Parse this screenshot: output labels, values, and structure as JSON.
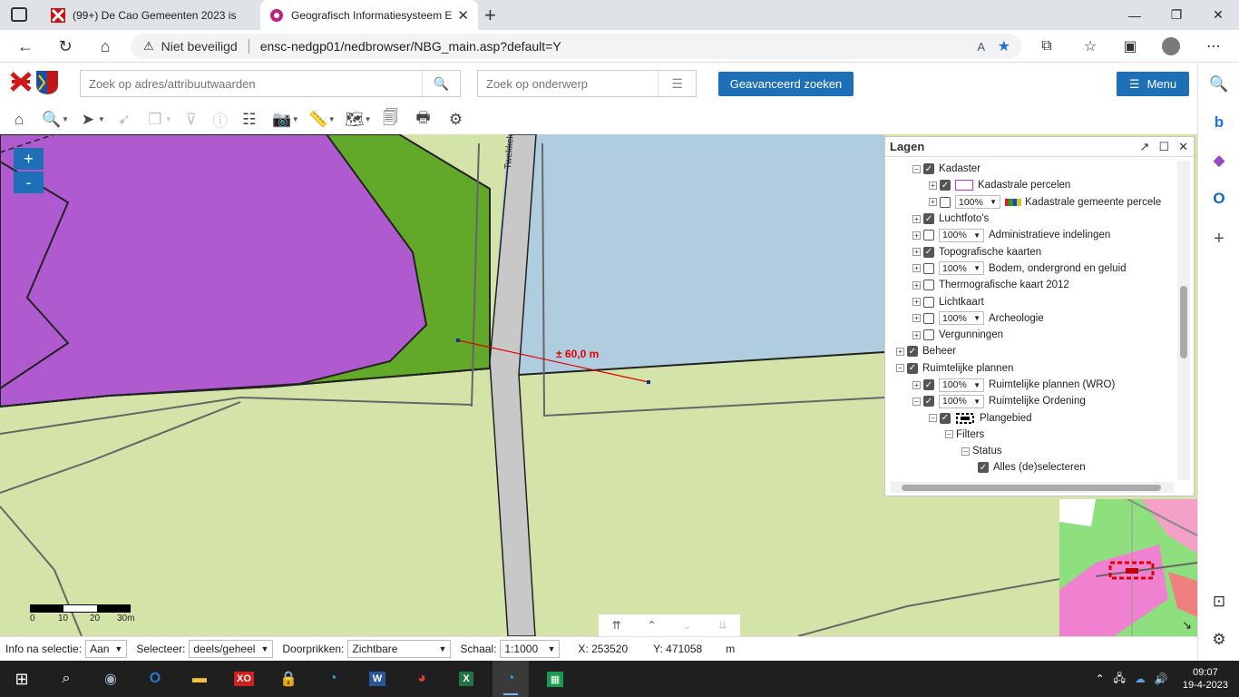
{
  "browser": {
    "tabs": [
      {
        "title": "(99+) De Cao Gemeenten 2023 is"
      },
      {
        "title": "Geografisch Informatiesysteem E"
      }
    ],
    "address": {
      "security": "Niet beveiligd",
      "url": "ensc-nedgp01/nedbrowser/NBG_main.asp?default=Y"
    }
  },
  "app": {
    "search_address_placeholder": "Zoek op adres/attribuutwaarden",
    "search_subject_placeholder": "Zoek op onderwerp",
    "advanced_search": "Geavanceerd zoeken",
    "menu": "Menu"
  },
  "map": {
    "zoom_in": "+",
    "zoom_out": "-",
    "road_name": "Twekkelerbeekweg",
    "measurement": "± 60,0 m",
    "scale_labels": [
      "0",
      "10",
      "20",
      "30m"
    ]
  },
  "layers_panel": {
    "title": "Lagen",
    "rows": [
      {
        "indent": 1,
        "exp": "-",
        "check": true,
        "label": "Kadaster"
      },
      {
        "indent": 2,
        "exp": "+",
        "check": true,
        "swatch": true,
        "label": "Kadastrale percelen"
      },
      {
        "indent": 2,
        "exp": "+",
        "check": false,
        "pct": "100%",
        "legend": true,
        "label": "Kadastrale gemeente percele"
      },
      {
        "indent": 1,
        "exp": "+",
        "check": true,
        "label": "Luchtfoto's"
      },
      {
        "indent": 1,
        "exp": "+",
        "check": false,
        "pct": "100%",
        "label": "Administratieve indelingen"
      },
      {
        "indent": 1,
        "exp": "+",
        "check": true,
        "label": "Topografische kaarten"
      },
      {
        "indent": 1,
        "exp": "+",
        "check": false,
        "pct": "100%",
        "label": "Bodem, ondergrond en geluid"
      },
      {
        "indent": 1,
        "exp": "+",
        "check": false,
        "label": "Thermografische kaart 2012"
      },
      {
        "indent": 1,
        "exp": "+",
        "check": false,
        "label": "Lichtkaart"
      },
      {
        "indent": 1,
        "exp": "+",
        "check": false,
        "pct": "100%",
        "label": "Archeologie"
      },
      {
        "indent": 1,
        "exp": "+",
        "check": false,
        "label": "Vergunningen"
      },
      {
        "indent": 0,
        "exp": "+",
        "check": true,
        "label": "Beheer"
      },
      {
        "indent": 0,
        "exp": "-",
        "check": true,
        "label": "Ruimtelijke plannen"
      },
      {
        "indent": 1,
        "exp": "+",
        "check": true,
        "pct": "100%",
        "label": "Ruimtelijke plannen (WRO)"
      },
      {
        "indent": 1,
        "exp": "-",
        "check": true,
        "pct": "100%",
        "label": "Ruimtelijke Ordening"
      },
      {
        "indent": 2,
        "exp": "-",
        "check": true,
        "planicon": true,
        "label": "Plangebied"
      },
      {
        "indent": 3,
        "exp": "-",
        "label": "Filters"
      },
      {
        "indent": 4,
        "exp": "-",
        "label": "Status"
      },
      {
        "indent": 5,
        "check": true,
        "label": "Alles (de)selecteren"
      }
    ]
  },
  "statusbar": {
    "info_label": "Info na selectie:",
    "info_value": "Aan",
    "select_label": "Selecteer:",
    "select_value": "deels/geheel",
    "pierce_label": "Doorprikken:",
    "pierce_value": "Zichtbare",
    "scale_label": "Schaal:",
    "scale_value": "1:1000",
    "x": "X: 253520",
    "y": "Y: 471058",
    "unit": "m"
  },
  "taskbar": {
    "time": "09:07",
    "date": "19-4-2023"
  },
  "colors": {
    "accent": "#1d6fb8",
    "purple_zone": "#b05ad0",
    "green_zone": "#62a829",
    "blue_zone": "#b0cde0",
    "light_green": "#d4e4a8",
    "measure_red": "#e00000"
  }
}
